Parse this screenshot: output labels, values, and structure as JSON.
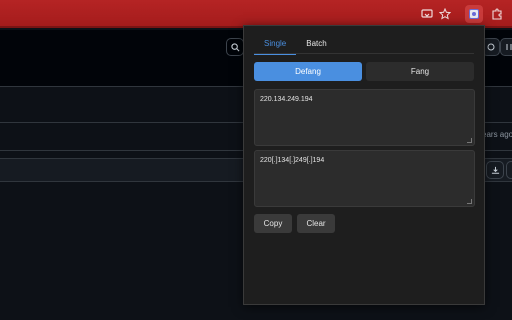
{
  "browser": {
    "icons": [
      "screen-cast-icon",
      "star-icon",
      "extension-active-icon",
      "puzzle-icon"
    ]
  },
  "page": {
    "timestamp_fragment": "ears ago"
  },
  "popup": {
    "tabs": [
      {
        "label": "Single",
        "active": true
      },
      {
        "label": "Batch",
        "active": false
      }
    ],
    "modes": {
      "defang_label": "Defang",
      "fang_label": "Fang",
      "selected": "Defang"
    },
    "input_value": "220.134.249.194",
    "output_value": "220[.]134[.]249[.]194",
    "actions": {
      "copy_label": "Copy",
      "clear_label": "Clear"
    },
    "colors": {
      "accent": "#4a8fe0",
      "panel": "#1e1e1e",
      "toolbar": "#b52424"
    }
  }
}
